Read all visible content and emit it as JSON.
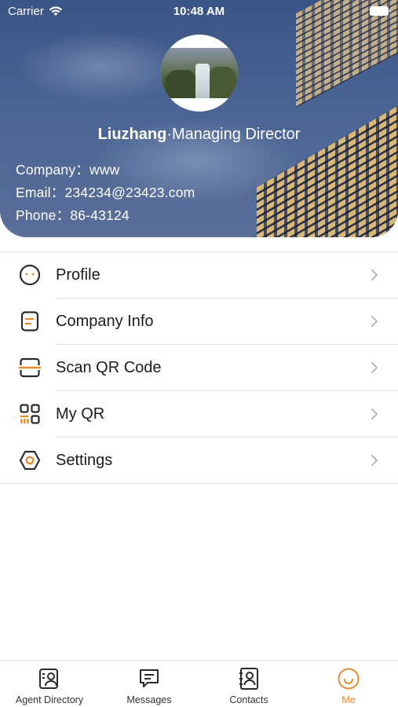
{
  "status_bar": {
    "carrier": "Carrier",
    "time": "10:48 AM"
  },
  "profile": {
    "name": "Liuzhang",
    "separator": "·",
    "title": "Managing Director",
    "company_label": "Company：",
    "company": "www",
    "email_label": "Email：",
    "email": "234234@23423.com",
    "phone_label": "Phone：",
    "phone": "86-43124"
  },
  "menu": {
    "items": [
      {
        "label": "Profile",
        "icon": "smiley-icon"
      },
      {
        "label": "Company Info",
        "icon": "document-icon"
      },
      {
        "label": "Scan QR Code",
        "icon": "scan-icon"
      },
      {
        "label": "My QR",
        "icon": "qr-icon"
      },
      {
        "label": "Settings",
        "icon": "hexagon-gear-icon"
      }
    ]
  },
  "tabbar": {
    "items": [
      {
        "label": "Agent Directory",
        "icon": "agent-directory-icon"
      },
      {
        "label": "Messages",
        "icon": "messages-icon"
      },
      {
        "label": "Contacts",
        "icon": "contacts-icon"
      },
      {
        "label": "Me",
        "icon": "me-icon",
        "active": true
      }
    ]
  },
  "colors": {
    "accent": "#e68a2e",
    "header_blue": "#4a6494",
    "icon_dark": "#2b2b2b"
  }
}
